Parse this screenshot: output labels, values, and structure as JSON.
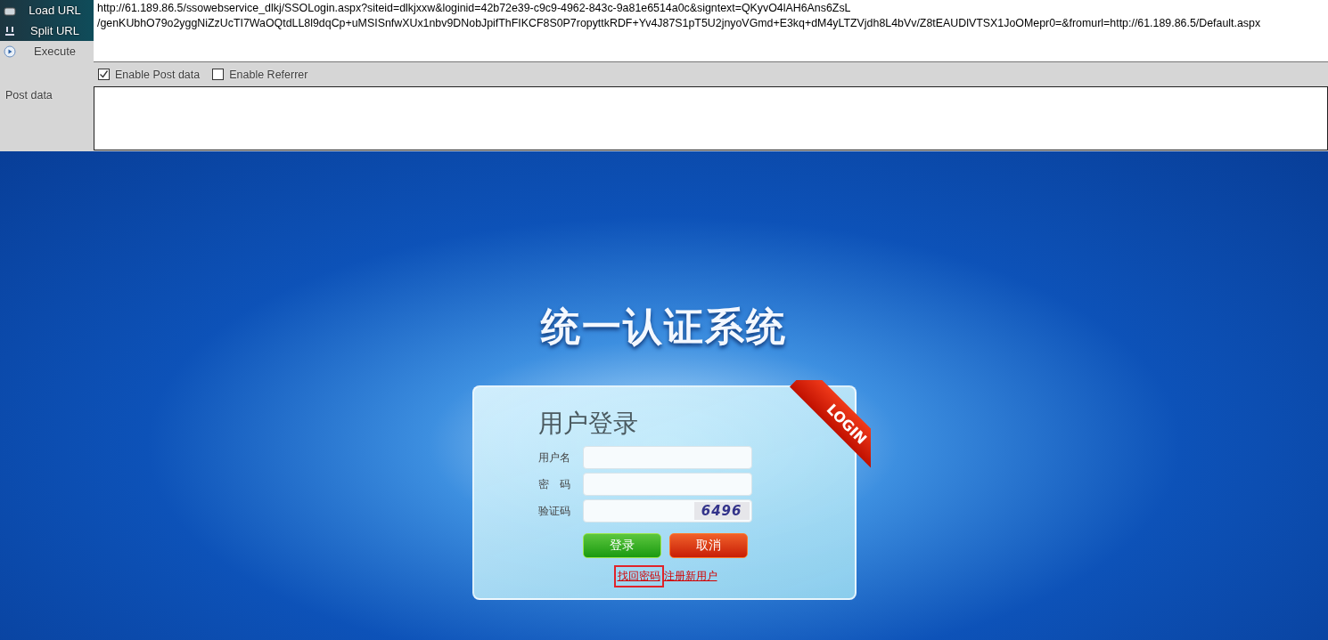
{
  "toolbar": {
    "buttons": [
      {
        "label": "Load URL",
        "kind": "load"
      },
      {
        "label": "Split URL",
        "kind": "split"
      },
      {
        "label": "Execute",
        "kind": "execute"
      }
    ],
    "url_lines": [
      "http://61.189.86.5/ssowebservice_dlkj/SSOLogin.aspx?siteid=dlkjxxw&loginid=42b72e39-c9c9-4962-843c-9a81e6514a0c&signtext=QKyvO4lAH6Ans6ZsL",
      "/genKUbhO79o2yggNiZzUcTI7WaOQtdLL8l9dqCp+uMSISnfwXUx1nbv9DNobJpifThFIKCF8S0P7ropyttkRDF+Yv4J87S1pT5U2jnyoVGmd+E3kq+dM4yLTZVjdh8L4bVv/Z8tEAUDlVTSX1JoOMepr0=&fromurl=http://61.189.86.5/Default.aspx"
    ],
    "options": [
      {
        "label": "Enable Post data",
        "checked": true
      },
      {
        "label": "Enable Referrer",
        "checked": false
      }
    ],
    "post_data_label": "Post data"
  },
  "page": {
    "title": "统一认证系统",
    "login": {
      "heading": "用户登录",
      "ribbon": "LOGIN",
      "fields": [
        {
          "label": "用户名",
          "kind": "text"
        },
        {
          "label": "密　码",
          "kind": "password"
        },
        {
          "label": "验证码",
          "kind": "captcha",
          "captcha": "6496"
        }
      ],
      "buttons": [
        {
          "label": "登录",
          "kind": "submit"
        },
        {
          "label": "取消",
          "kind": "cancel"
        }
      ],
      "links": [
        {
          "label": "找回密码",
          "highlighted": true
        },
        {
          "label": "注册新用户",
          "highlighted": false
        }
      ]
    }
  }
}
